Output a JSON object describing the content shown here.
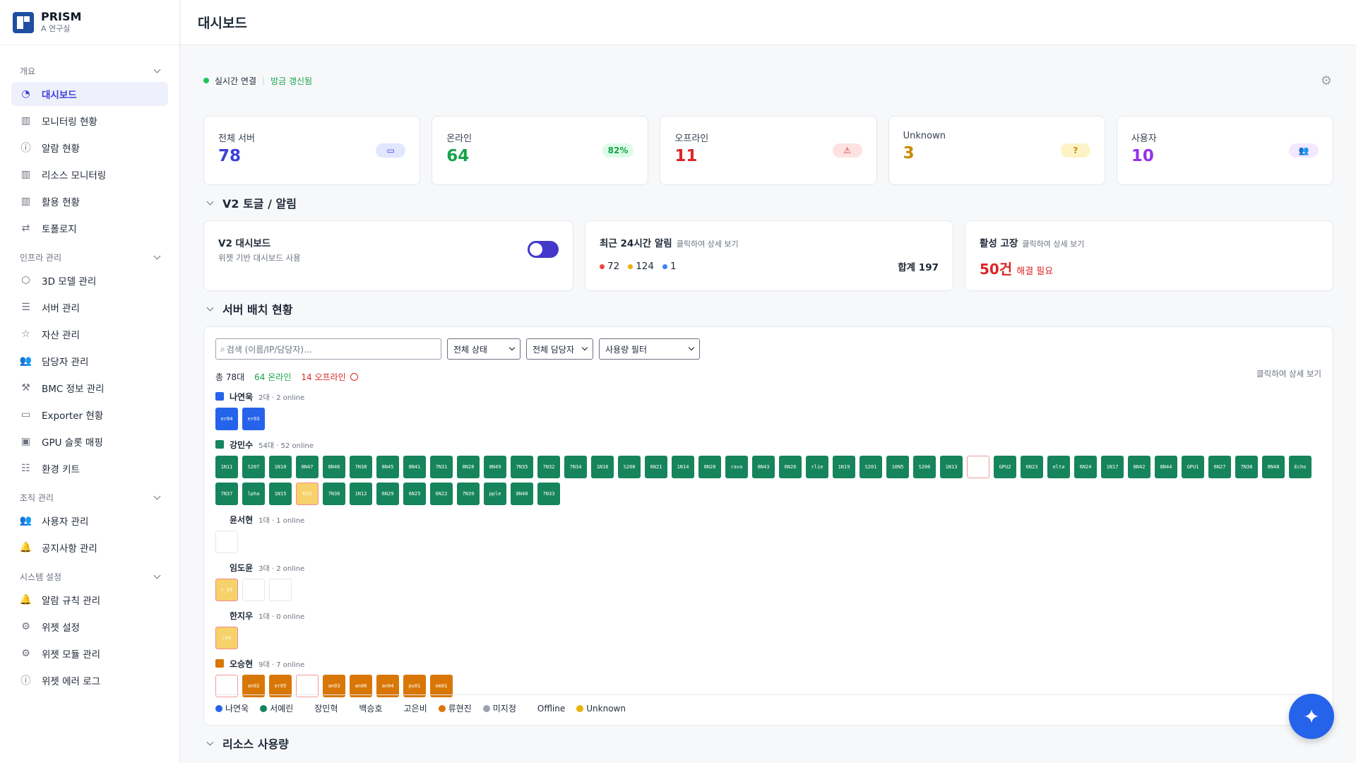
{
  "brand": {
    "name": "PRISM",
    "sub": "A 연구실"
  },
  "header": {
    "title": "대시보드"
  },
  "sidebar": {
    "groups": [
      {
        "label": "개요",
        "items": [
          {
            "label": "대시보드",
            "icon": "pie-chart-icon",
            "active": true
          },
          {
            "label": "모니터링 현황",
            "icon": "bar-chart-icon"
          },
          {
            "label": "알람 현황",
            "icon": "alert-circle-icon"
          },
          {
            "label": "리소스 모니터링",
            "icon": "bar-chart-icon"
          },
          {
            "label": "활용 현황",
            "icon": "bar-chart-icon"
          },
          {
            "label": "토폴로지",
            "icon": "arrows-icon"
          }
        ]
      },
      {
        "label": "인프라 관리",
        "items": [
          {
            "label": "3D 모델 관리",
            "icon": "cube-icon"
          },
          {
            "label": "서버 관리",
            "icon": "server-icon"
          },
          {
            "label": "자산 관리",
            "icon": "star-icon"
          },
          {
            "label": "담당자 관리",
            "icon": "users-icon"
          },
          {
            "label": "BMC 정보 관리",
            "icon": "wrench-icon"
          },
          {
            "label": "Exporter 현황",
            "icon": "monitor-icon"
          },
          {
            "label": "GPU 슬롯 매핑",
            "icon": "chip-icon"
          },
          {
            "label": "환경 키트",
            "icon": "database-icon"
          }
        ]
      },
      {
        "label": "조직 관리",
        "items": [
          {
            "label": "사용자 관리",
            "icon": "users-icon"
          },
          {
            "label": "공지사항 관리",
            "icon": "bell-icon"
          }
        ]
      },
      {
        "label": "시스템 설정",
        "items": [
          {
            "label": "알람 규칙 관리",
            "icon": "bell-icon"
          },
          {
            "label": "위젯 설정",
            "icon": "gear-icon"
          },
          {
            "label": "위젯 모듈 관리",
            "icon": "gear-icon"
          },
          {
            "label": "위젯 에러 로그",
            "icon": "alert-circle-icon"
          }
        ]
      }
    ]
  },
  "status": {
    "connection": "실시간 연결",
    "refresh": "방금 갱신됨"
  },
  "cards": [
    {
      "label": "전체 서버",
      "value": "78",
      "color": "#3b3fd8",
      "badge": "",
      "badge_icon": "monitor-icon",
      "badge_bg": "#e0e7ff",
      "badge_color": "#3b3fd8"
    },
    {
      "label": "온라인",
      "value": "64",
      "color": "#16a34a",
      "badge": "82%",
      "badge_icon": "",
      "badge_bg": "#dcfce7",
      "badge_color": "#16a34a"
    },
    {
      "label": "오프라인",
      "value": "11",
      "color": "#dc2626",
      "badge": "",
      "badge_icon": "warning-icon",
      "badge_bg": "#fee2e2",
      "badge_color": "#dc2626"
    },
    {
      "label": "Unknown",
      "value": "3",
      "color": "#ca8a04",
      "badge": "",
      "badge_icon": "question-icon",
      "badge_bg": "#fef3c7",
      "badge_color": "#ca8a04"
    },
    {
      "label": "사용자",
      "value": "10",
      "color": "#9333ea",
      "badge": "",
      "badge_icon": "users-icon",
      "badge_bg": "#f3e8ff",
      "badge_color": "#9333ea"
    }
  ],
  "sections": {
    "v2": "V2 토글 / 알림",
    "rack": "서버 배치 현황",
    "resource": "리소스 사용량"
  },
  "v2": {
    "title": "V2 대시보드",
    "sub": "위젯 기반 대시보드 사용"
  },
  "alerts": {
    "title": "최근 24시간 알림",
    "hint": "클릭하여 상세 보기",
    "red": "72",
    "yellow": "124",
    "blue": "1",
    "total": "합계 197"
  },
  "faults": {
    "title": "활성 고장",
    "hint": "클릭하여 상세 보기",
    "count": "50건",
    "note": "해결 필요"
  },
  "rack": {
    "search_placeholder": "검색 (이름/IP/담당자)...",
    "filters": [
      "전체 상태",
      "전체 담당자",
      "사용량 필터"
    ],
    "total": "총 78대",
    "online": "64 온라인",
    "offline": "14 오프라인",
    "more": "클릭하여 상세 보기",
    "owners": [
      {
        "name": "나연욱",
        "meta": "2대 · 2 online",
        "color": "#2563eb",
        "tiles": [
          [
            "er04",
            "blue"
          ],
          [
            "er03",
            "blue"
          ]
        ]
      },
      {
        "name": "강민수",
        "meta": "54대 · 52 online",
        "color": "#16845c",
        "tiles": [
          [
            "1N11",
            "green"
          ],
          [
            "S207",
            "green"
          ],
          [
            "1N10",
            "green"
          ],
          [
            "8N47",
            "green"
          ],
          [
            "8N46",
            "green"
          ],
          [
            "7N38",
            "green"
          ],
          [
            "8N45",
            "green"
          ],
          [
            "8N41",
            "green"
          ],
          [
            "7N31",
            "green"
          ],
          [
            "8N28",
            "green"
          ],
          [
            "8N49",
            "green"
          ],
          [
            "7N35",
            "green"
          ],
          [
            "7N32",
            "green"
          ],
          [
            "7N34",
            "green"
          ],
          [
            "1N16",
            "green"
          ],
          [
            "S208",
            "green"
          ],
          [
            "6N21",
            "green"
          ],
          [
            "1N14",
            "green"
          ],
          [
            "8N20",
            "green"
          ],
          [
            "ravo",
            "green"
          ],
          [
            "8N43",
            "green"
          ],
          [
            "6N26",
            "green"
          ],
          [
            "rlie",
            "green"
          ],
          [
            "1N19",
            "green"
          ],
          [
            "S201",
            "green"
          ],
          [
            "10N5",
            "green"
          ],
          [
            "S206",
            "green"
          ],
          [
            "1N13",
            "green"
          ],
          [
            "",
            "redline"
          ],
          [
            "GPU2",
            "green"
          ],
          [
            "6N23",
            "green"
          ],
          [
            "elta",
            "green"
          ],
          [
            "6N24",
            "green"
          ],
          [
            "1N17",
            "green"
          ],
          [
            "8N42",
            "green"
          ],
          [
            "8N44",
            "green"
          ],
          [
            "GPU1",
            "green"
          ],
          [
            "6N27",
            "green"
          ],
          [
            "7N30",
            "green"
          ],
          [
            "8N48",
            "green"
          ],
          [
            "Echo",
            "green"
          ],
          [
            "7N37",
            "green"
          ],
          [
            "lpha",
            "green"
          ],
          [
            "1N15",
            "green"
          ],
          [
            "N18",
            "yellow"
          ],
          [
            "7N36",
            "green"
          ],
          [
            "1N12",
            "green"
          ],
          [
            "6N29",
            "green"
          ],
          [
            "6N25",
            "green"
          ],
          [
            "6N22",
            "green"
          ],
          [
            "7N39",
            "green"
          ],
          [
            "pple",
            "green"
          ],
          [
            "8N40",
            "green"
          ],
          [
            "7N33",
            "green"
          ]
        ]
      },
      {
        "name": "윤서현",
        "meta": "1대 · 1 online",
        "color": "",
        "tiles": [
          [
            "",
            "empty"
          ]
        ]
      },
      {
        "name": "임도윤",
        "meta": "3대 · 2 online",
        "color": "",
        "tiles": [
          [
            "r_01",
            "yellow"
          ],
          [
            "",
            "empty"
          ],
          [
            "",
            "empty"
          ]
        ]
      },
      {
        "name": "한지우",
        "meta": "1대 · 0 online",
        "color": "",
        "tiles": [
          [
            "C04",
            "yellow"
          ]
        ]
      },
      {
        "name": "오승현",
        "meta": "9대 · 7 online",
        "color": "#d97706",
        "tiles": [
          [
            "",
            "redline"
          ],
          [
            "an02",
            "orange"
          ],
          [
            "er05",
            "orange"
          ],
          [
            "",
            "redline"
          ],
          [
            "an03",
            "orange"
          ],
          [
            "an06",
            "orange"
          ],
          [
            "an04",
            "orange"
          ],
          [
            "pu01",
            "orange"
          ],
          [
            "em01",
            "orange"
          ]
        ]
      }
    ],
    "legend": [
      {
        "label": "나연욱",
        "color": "#2563eb"
      },
      {
        "label": "서예린",
        "color": "#16845c"
      },
      {
        "label": "장민혁",
        "color": ""
      },
      {
        "label": "백승호",
        "color": ""
      },
      {
        "label": "고은비",
        "color": ""
      },
      {
        "label": "류현진",
        "color": "#d97706"
      },
      {
        "label": "미지정",
        "color": "#9ca3af"
      },
      {
        "label": "Offline",
        "color": ""
      },
      {
        "label": "Unknown",
        "color": "#eab308"
      }
    ]
  }
}
